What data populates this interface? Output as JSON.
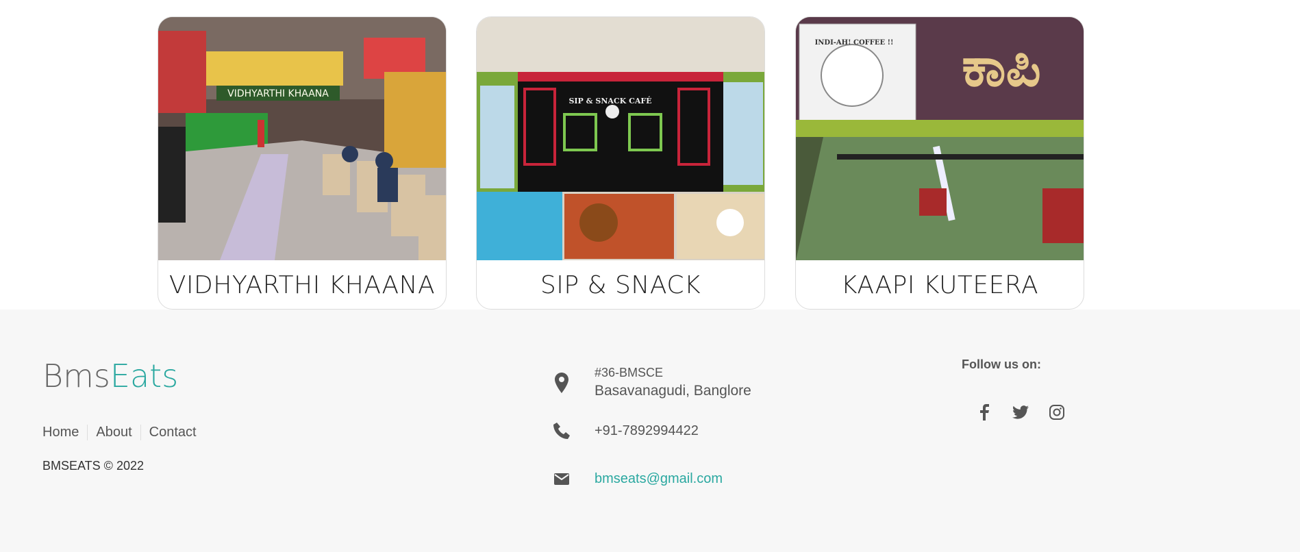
{
  "cards": [
    {
      "title": "VIDHYARTHI KHAANA",
      "sign_text": "VIDHYARTHI KHAANA"
    },
    {
      "title": "SIP & SNACK",
      "sign_text": "SIP & SNACK CAFÉ"
    },
    {
      "title": "KAAPI KUTEERA",
      "sign_text": "ಕಾಪಿ",
      "sign_small": "INDI-AH! COFFEE !!"
    }
  ],
  "footer": {
    "logo_main": "Bms",
    "logo_accent": "Eats",
    "links": [
      "Home",
      "About",
      "Contact"
    ],
    "copyright": "BMSEATS © 2022",
    "address_line1": "#36-BMSCE",
    "address_line2": "Basavanagudi, Banglore",
    "phone": "+91-7892994422",
    "email": "bmseats@gmail.com",
    "follow_label": "Follow us on:",
    "social": [
      "facebook-icon",
      "twitter-icon",
      "instagram-icon"
    ]
  },
  "colors": {
    "accent": "#2aa8a0",
    "footer_bg": "#f7f7f7",
    "text": "#555555"
  }
}
